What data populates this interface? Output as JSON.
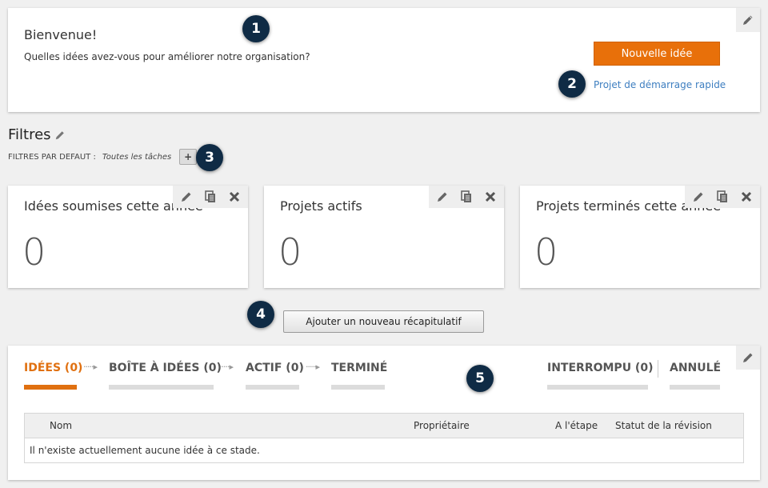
{
  "welcome": {
    "title": "Bienvenue!",
    "subtitle": "Quelles idées avez-vous pour améliorer notre organisation?",
    "new_idea_button": "Nouvelle idée",
    "quick_start_link": "Projet de démarrage rapide"
  },
  "callouts": [
    "1",
    "2",
    "3",
    "4",
    "5"
  ],
  "filters": {
    "title": "Filtres",
    "default_label": "FILTRES PAR DEFAUT :",
    "default_value": "Toutes les tâches",
    "add_label": "+"
  },
  "summaries": [
    {
      "title": "Idées soumises cette année",
      "value": "0"
    },
    {
      "title": "Projets actifs",
      "value": "0"
    },
    {
      "title": "Projets terminés cette année",
      "value": "0"
    }
  ],
  "add_summary_button": "Ajouter un nouveau récapitulatif",
  "stages": {
    "tabs": [
      {
        "label": "IDÉES (0)",
        "active": true
      },
      {
        "label": "BOÎTE À IDÉES (0)",
        "active": false
      },
      {
        "label": "ACTIF (0)",
        "active": false
      },
      {
        "label": "TERMINÉ",
        "active": false
      },
      {
        "label": "INTERROMPU (0)",
        "active": false
      },
      {
        "label": "ANNULÉ",
        "active": false
      }
    ],
    "arrow": "·····▸"
  },
  "table": {
    "headers": [
      "Nom",
      "Propriétaire",
      "A l'étape",
      "Statut de la révision"
    ],
    "empty_message": "Il n'existe actuellement aucune idée à ce stade."
  },
  "colors": {
    "accent": "#e8700a",
    "link": "#3d7ec0",
    "callout": "#0f2b45"
  },
  "icons": {
    "edit": "pencil-icon",
    "copy": "copy-icon",
    "close": "close-icon"
  }
}
